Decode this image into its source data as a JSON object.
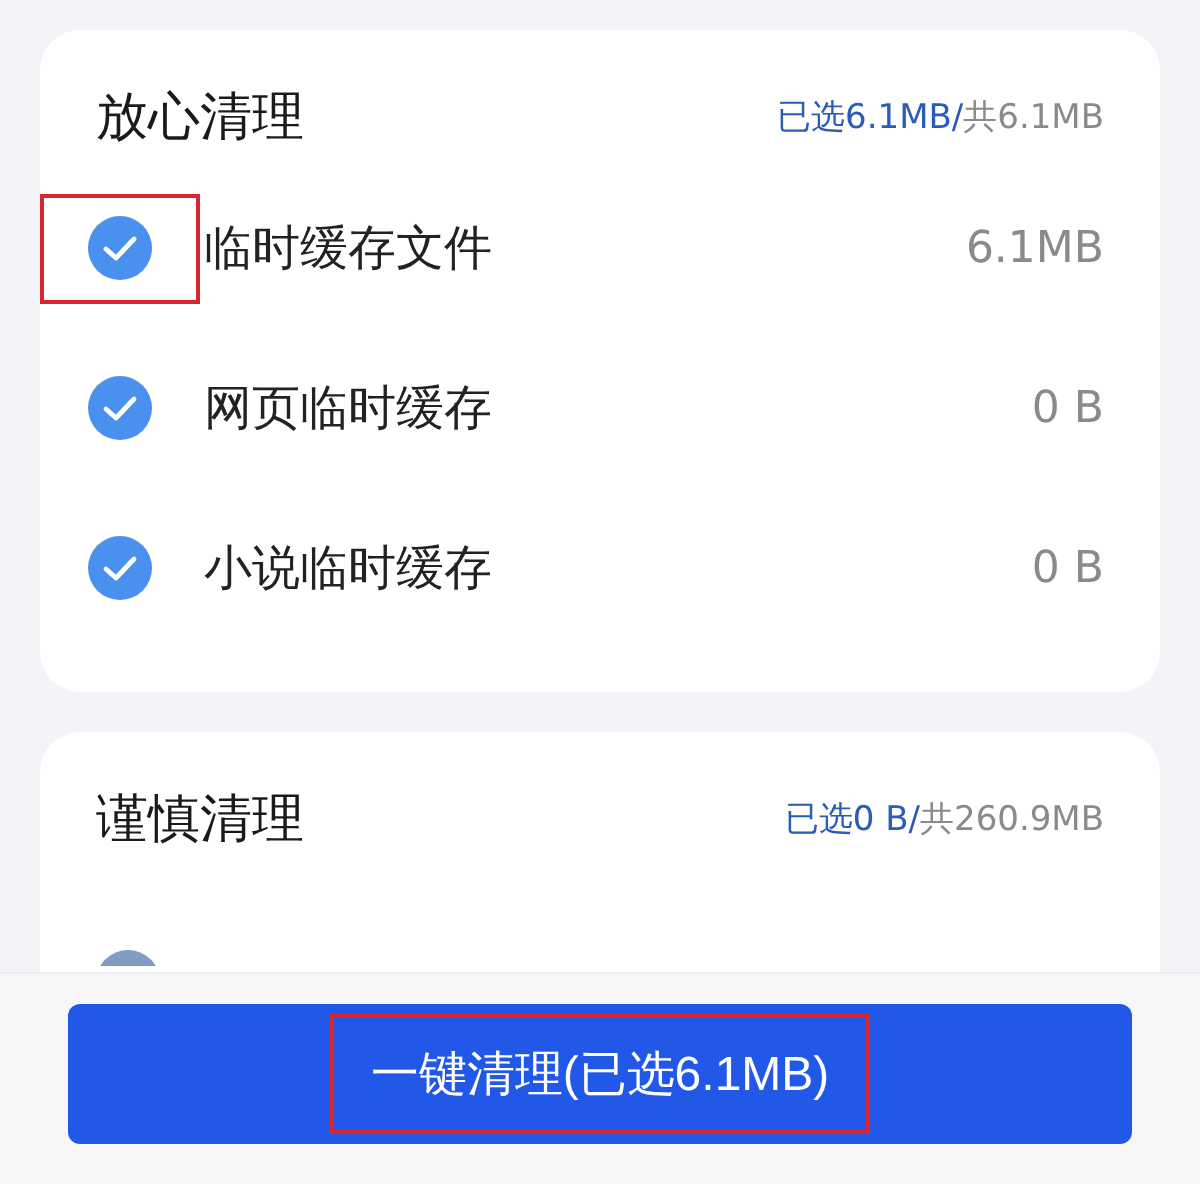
{
  "sections": [
    {
      "title": "放心清理",
      "selected_summary": "已选6.1MB/",
      "total_summary": "共6.1MB",
      "items": [
        {
          "kind": "row",
          "label": "临时缓存文件",
          "size": "6.1MB",
          "checked": true,
          "highlighted": true
        },
        {
          "kind": "row",
          "label": "网页临时缓存",
          "size": "0 B",
          "checked": true,
          "highlighted": false
        },
        {
          "kind": "row",
          "label": "小说临时缓存",
          "size": "0 B",
          "checked": true,
          "highlighted": false
        }
      ]
    },
    {
      "title": "谨慎清理",
      "selected_summary": "已选0 B/",
      "total_summary": "共260.9MB",
      "items": [
        {
          "kind": "cut",
          "checked": false
        }
      ]
    }
  ],
  "clean_button": {
    "label": "一键清理(已选6.1MB)",
    "highlighted": true
  }
}
